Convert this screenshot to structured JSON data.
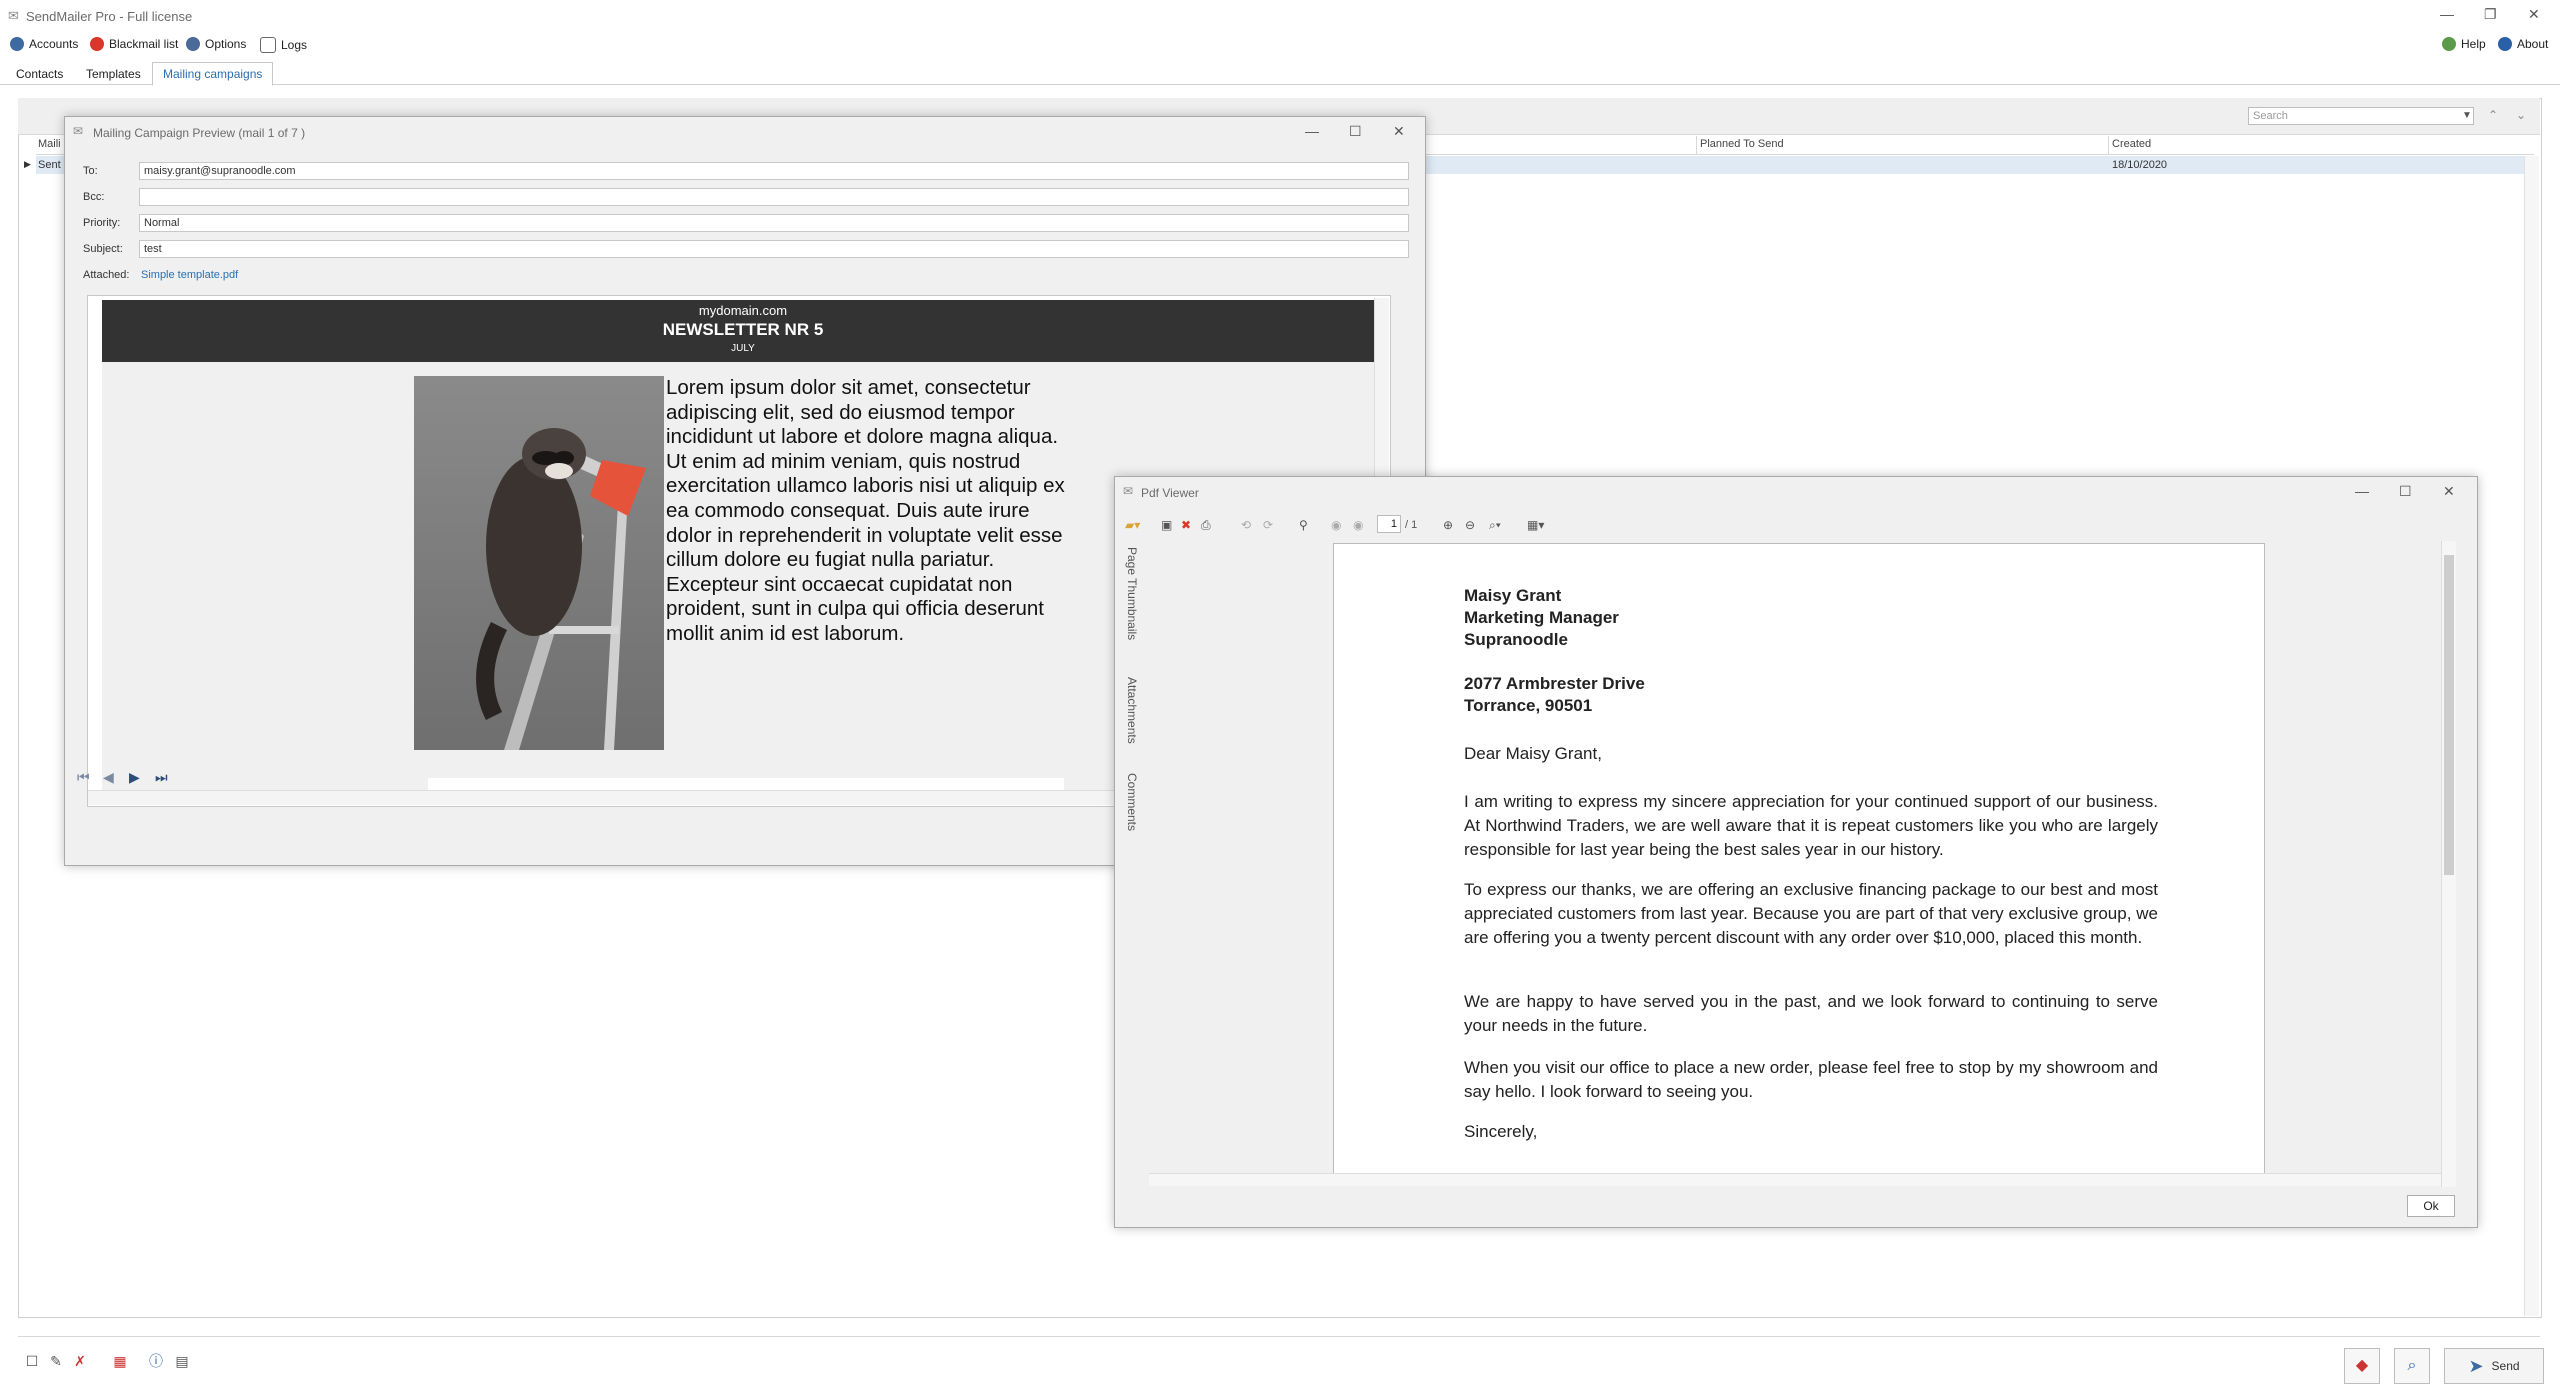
{
  "app": {
    "title": "SendMailer Pro - Full license"
  },
  "menu": {
    "items": [
      "Accounts",
      "Blackmail list",
      "Options",
      "Logs"
    ],
    "help": "Help",
    "about": "About"
  },
  "tabs": [
    "Contacts",
    "Templates",
    "Mailing campaigns"
  ],
  "main": {
    "search_placeholder": "Search",
    "columns": [
      "Maili",
      "Planned To Send",
      "Created"
    ],
    "row": {
      "name": "Sent",
      "planned": "",
      "created": "18/10/2020"
    }
  },
  "footer": {
    "send_label": "Send"
  },
  "preview": {
    "title": "Mailing Campaign Preview (mail 1 of 7 )",
    "labels": {
      "to": "To:",
      "bcc": "Bcc:",
      "priority": "Priority:",
      "subject": "Subject:",
      "attached": "Attached:"
    },
    "values": {
      "to": "maisy.grant@supranoodle.com",
      "bcc": "",
      "priority": "Normal",
      "subject": "test",
      "attached": "Simple template.pdf"
    },
    "newsletter": {
      "domain": "mydomain.com",
      "title": "NEWSLETTER NR 5",
      "month": "JULY",
      "lorem": "Lorem ipsum dolor sit amet, consectetur adipiscing elit, sed do eiusmod tempor incididunt ut labore et dolore magna aliqua. Ut enim ad minim veniam, quis nostrud exercitation ullamco laboris nisi ut aliquip ex ea commodo consequat. Duis aute irure dolor in reprehenderit in voluptate velit esse cillum dolore eu fugiat nulla pariatur. Excepteur sint occaecat cupidatat non proident, sunt in culpa qui officia deserunt mollit anim id est laborum."
    }
  },
  "pdf": {
    "title": "Pdf Viewer",
    "page_current": "1",
    "page_total": "/ 1",
    "side_tabs": [
      "Page Thumbnails",
      "Attachments",
      "Comments"
    ],
    "letter": {
      "name": "Maisy Grant",
      "role": "Marketing Manager",
      "company": "Supranoodle",
      "street": "2077  Armbrester Drive",
      "city": "Torrance, 90501",
      "greeting": "Dear Maisy Grant,",
      "p1": "I am writing to express my sincere appreciation for your continued support of our business. At Northwind Traders, we are well aware that it is repeat customers like you who are largely responsible for last year being the best sales year in our history.",
      "p2": "To express our thanks, we are offering an exclusive financing package to our best and most appreciated customers from last year. Because you are part of that very exclusive group, we are offering you a twenty percent discount with any order over $10,000, placed this month.",
      "p3": "We are happy to have served you in the past, and we look forward to continuing to serve your needs in the future.",
      "p4": "When you visit our office to place a new order, please feel free to stop by my showroom and say hello. I look forward to seeing you.",
      "closing": "Sincerely,"
    },
    "ok_label": "Ok"
  }
}
